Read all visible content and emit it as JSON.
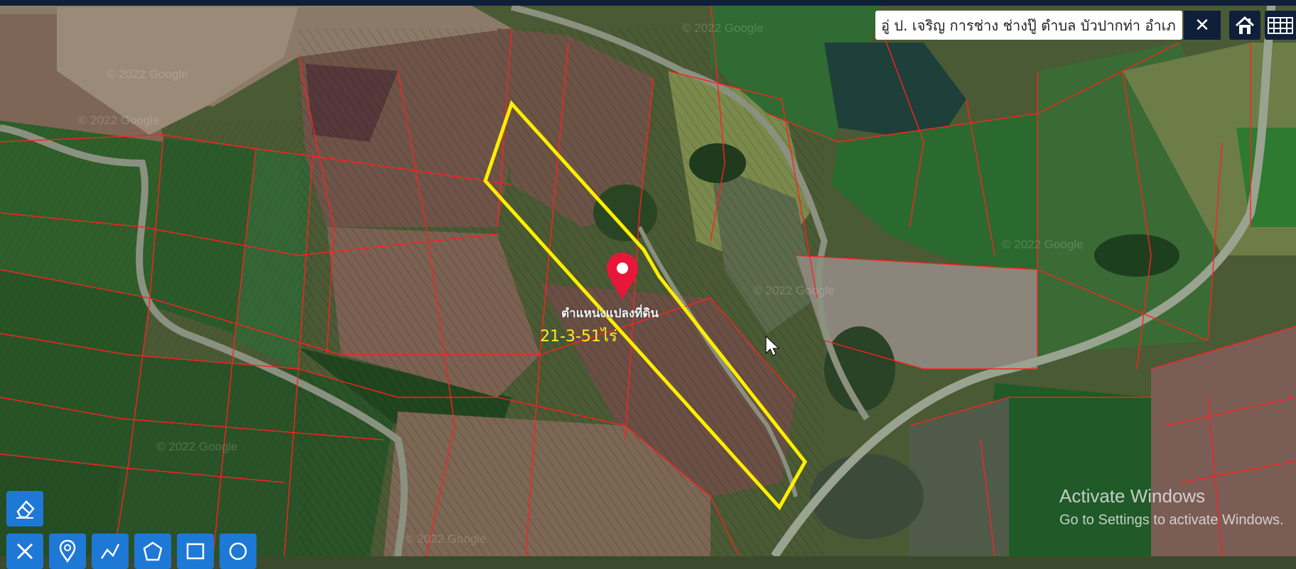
{
  "search": {
    "value": "อู่ ป. เจริญ การช่าง ช่างปู๊ ตำบล บัวปากท่า อำเภอ"
  },
  "buttons": {
    "clear_label": "✕"
  },
  "map": {
    "marker_label": "ตำแหน่งแปลงที่ดิน",
    "area_label": "21-3-51ไร่",
    "copyright": "© 2022 Google"
  },
  "watermark": {
    "title": "Activate Windows",
    "subtitle": "Go to Settings to activate Windows."
  },
  "colors": {
    "parcel_outline": "#ffee00",
    "cadastral_lines": "#ff2020",
    "marker": "#e8173a",
    "tool_button": "#1e78d6",
    "nav_dark": "#0f1f3a"
  },
  "tools": [
    {
      "name": "eraser-icon"
    },
    {
      "name": "measure-icon"
    },
    {
      "name": "pin-icon"
    },
    {
      "name": "polyline-icon"
    },
    {
      "name": "polygon-icon"
    },
    {
      "name": "rectangle-icon"
    },
    {
      "name": "circle-icon"
    }
  ]
}
